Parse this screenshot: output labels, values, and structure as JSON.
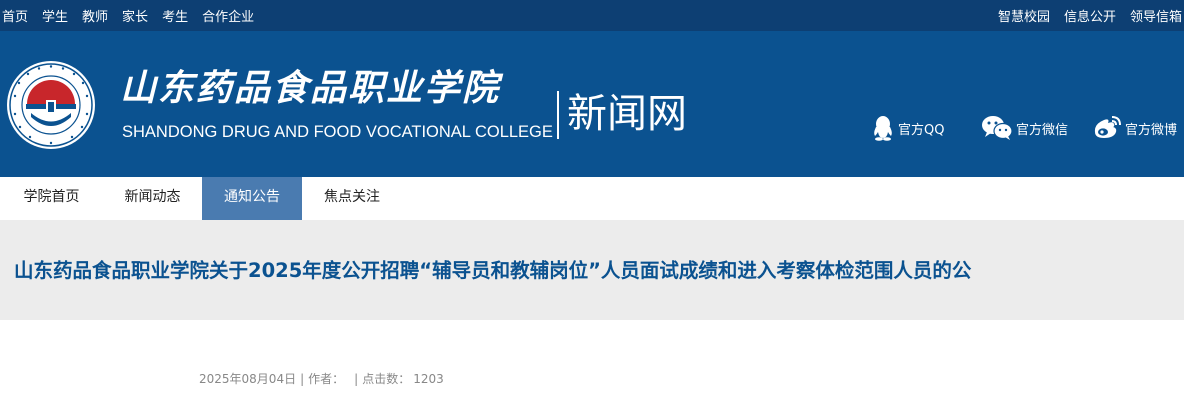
{
  "topbar": {
    "left_links": [
      "首页",
      "学生",
      "教师",
      "家长",
      "考生",
      "合作企业"
    ],
    "right_links": [
      "智慧校园",
      "信息公开",
      "领导信箱"
    ]
  },
  "header": {
    "school_name_cn": "山东药品食品职业学院",
    "school_name_en": "SHANDONG DRUG AND FOOD VOCATIONAL COLLEGE",
    "site_name": "新闻网",
    "logo_ring_text": "山东药品食品职业学院 SHANDONG DRUG AND FOOD VOCATIONAL COLLEGE",
    "social": {
      "qq": {
        "label": "官方QQ",
        "icon": "qq-penguin-icon"
      },
      "wechat": {
        "label": "官方微信",
        "icon": "wechat-icon"
      },
      "weibo": {
        "label": "官方微博",
        "icon": "weibo-icon"
      }
    }
  },
  "nav": {
    "items": [
      "学院首页",
      "新闻动态",
      "通知公告",
      "焦点关注"
    ],
    "active": "通知公告"
  },
  "article": {
    "title": "山东药品食品职业学院关于2025年度公开招聘“辅导员和教辅岗位”人员面试成绩和进入考察体检范围人员的公",
    "date": "2025年08月04日",
    "author_label": "作者：",
    "author": "",
    "hits_label": "点击数：",
    "hits": "1203"
  },
  "colors": {
    "topbar_bg": "#0d3f73",
    "header_bg": "#0b5290",
    "nav_active_bg": "#4a7bb0",
    "title_band_bg": "#ececec",
    "title_text": "#0b5290",
    "logo_red": "#c8262b"
  }
}
